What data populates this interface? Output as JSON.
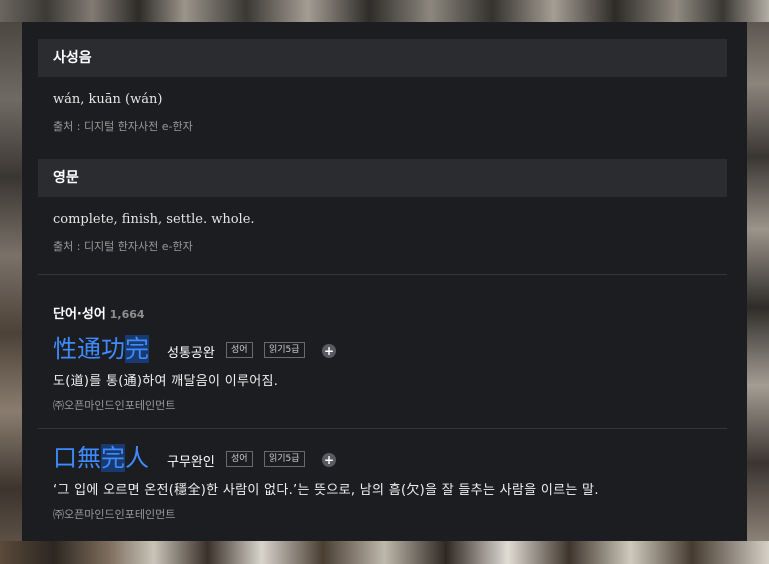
{
  "sections": {
    "pronunciation": {
      "title": "사성음",
      "text": "wán, kuān (wán)",
      "source": "출처 : 디지털 한자사전 e-한자"
    },
    "english": {
      "title": "영문",
      "text": "complete, finish, settle. whole.",
      "source": "출처 : 디지털 한자사전 e-한자"
    }
  },
  "words": {
    "title": "단어·성어",
    "count": "1,664",
    "entries": [
      {
        "hanja_prefix": "性通功",
        "hanja_highlight": "完",
        "reading": "성통공완",
        "tag1": "성어",
        "tag2": "읽기5급",
        "plus": "+",
        "meaning": "도(道)를 통(通)하여 깨달음이 이루어짐.",
        "source": "㈜오픈마인드인포테인먼트"
      },
      {
        "hanja_prefix": "口無",
        "hanja_highlight": "完",
        "hanja_suffix": "人",
        "reading": "구무완인",
        "tag1": "성어",
        "tag2": "읽기5급",
        "plus": "+",
        "meaning": "‘그 입에 오르면 온전(穩全)한 사람이 없다.’는 뜻으로, 남의 흠(欠)을 잘 들추는 사람을 이르는 말.",
        "source": "㈜오픈마인드인포테인먼트"
      }
    ]
  },
  "colors": {
    "panel_bg": "#1c1d20",
    "header_bg": "#2b2c30",
    "hanja_accent": "#3d8bff",
    "highlight_bg": "#183a6e"
  }
}
